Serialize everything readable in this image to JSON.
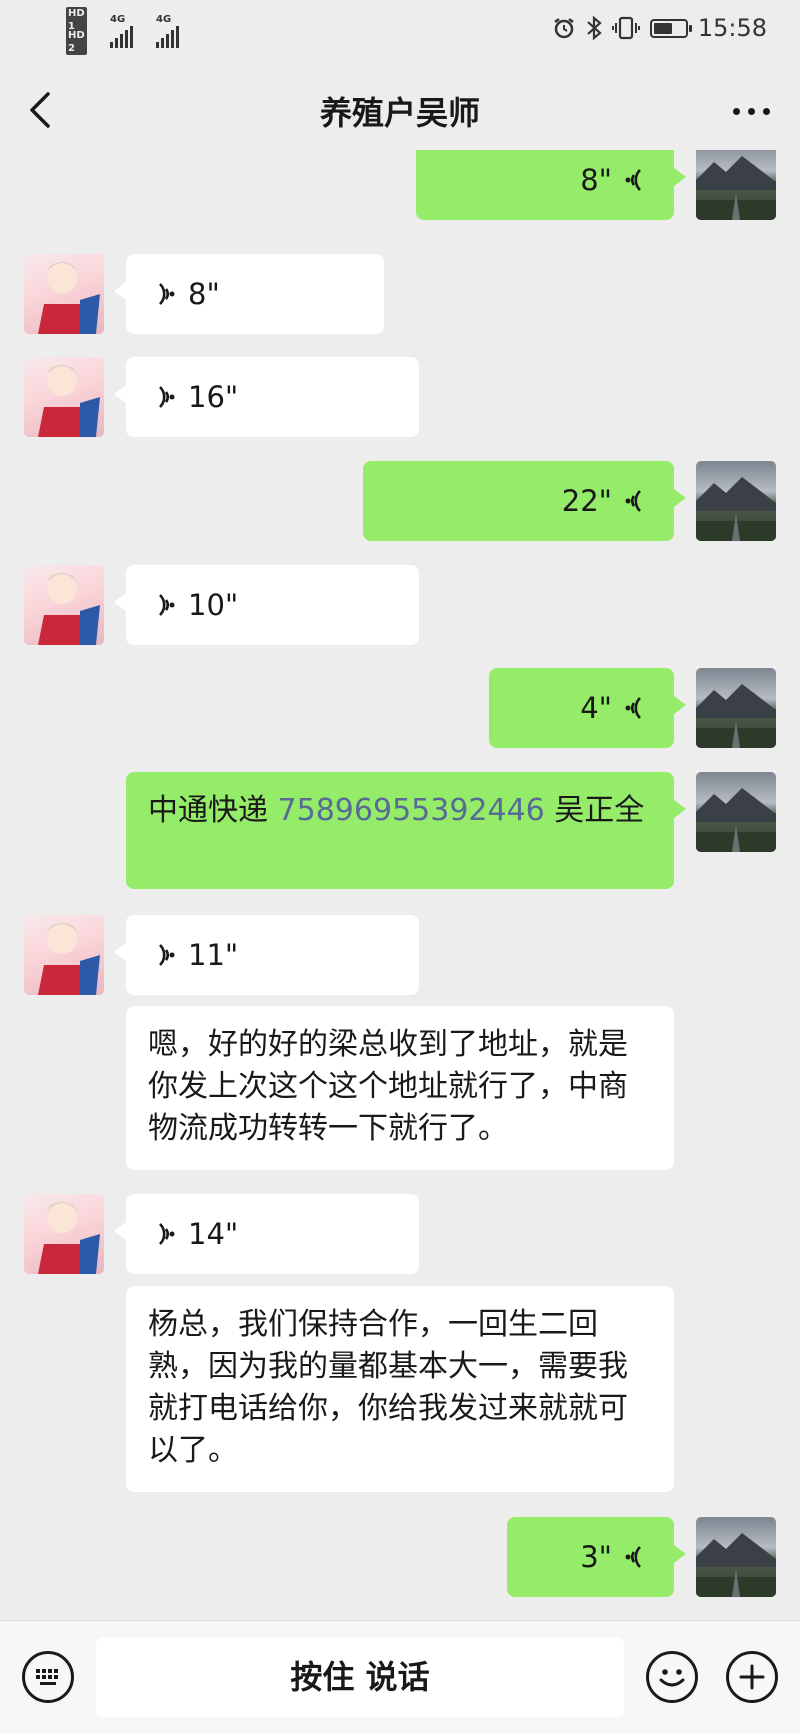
{
  "status_bar": {
    "hd1": "HD 1",
    "hd2": "HD 2",
    "net1": "4G",
    "net2": "4G",
    "time": "15:58"
  },
  "header": {
    "title": "养殖户吴师"
  },
  "messages": [
    {
      "side": "out",
      "type": "voice",
      "duration": "8\""
    },
    {
      "side": "in",
      "type": "voice",
      "duration": "8\""
    },
    {
      "side": "in",
      "type": "voice",
      "duration": "16\""
    },
    {
      "side": "out",
      "type": "voice",
      "duration": "22\""
    },
    {
      "side": "in",
      "type": "voice",
      "duration": "10\""
    },
    {
      "side": "out",
      "type": "voice",
      "duration": "4\""
    },
    {
      "side": "out",
      "type": "text",
      "text_pre": "中通快递 ",
      "link": "75896955392446",
      "text_post": " 吴正全"
    },
    {
      "side": "in",
      "type": "voice",
      "duration": "11\""
    },
    {
      "side": "in",
      "type": "text",
      "text": "嗯，好的好的梁总收到了地址，就是你发上次这个这个地址就行了，中商物流成功转转一下就行了。"
    },
    {
      "side": "in",
      "type": "voice",
      "duration": "14\""
    },
    {
      "side": "in",
      "type": "text",
      "text": "杨总，我们保持合作，一回生二回熟，因为我的量都基本大一，需要我就打电话给你，你给我发过来就就可以了。"
    },
    {
      "side": "out",
      "type": "voice",
      "duration": "3\""
    }
  ],
  "input_bar": {
    "hold_to_talk": "按住 说话"
  },
  "colors": {
    "outgoing_bubble": "#95ec69",
    "incoming_bubble": "#ffffff",
    "background": "#ededed",
    "link": "#576b95"
  },
  "icons": {
    "back": "chevron-left-icon",
    "more": "more-dots-icon",
    "keyboard": "keyboard-icon",
    "emoji": "emoji-icon",
    "plus": "plus-icon",
    "voice": "voice-wave-icon"
  }
}
